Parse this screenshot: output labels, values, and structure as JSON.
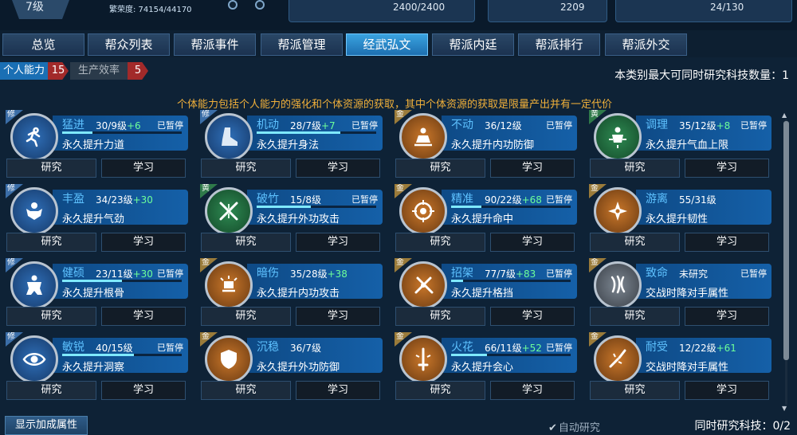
{
  "header": {
    "level": "7级",
    "prosperity": "繁荣度: 74154/44170",
    "stat1": "2400/2400",
    "stat2": "2209",
    "stat3": "24/130"
  },
  "tabs": [
    "总览",
    "帮众列表",
    "帮派事件",
    "帮派管理",
    "经武弘文",
    "帮派内廷",
    "帮派排行",
    "帮派外交"
  ],
  "active_tab": 4,
  "categories": [
    {
      "name": "个人能力",
      "count": "15"
    },
    {
      "name": "生产效率",
      "count": "5"
    }
  ],
  "max_research_label": "本类别最大可同时研究科技数量：1",
  "description": "个体能力包括个人能力的强化和个体资源的获取，其中个体资源的获取是限量产出并有一定代价",
  "labels": {
    "research": "研究",
    "learn": "学习",
    "paused": "已暂停"
  },
  "skills": [
    {
      "corner": "修",
      "name": "猛进",
      "level": "30/9级",
      "bonus": "+6",
      "effect": "永久提升力道",
      "paused": true,
      "progress": 0.25,
      "icon": "running-figure-icon",
      "color": "blue"
    },
    {
      "corner": "修",
      "name": "机动",
      "level": "28/7级",
      "bonus": "+7",
      "effect": "永久提升身法",
      "paused": true,
      "progress": 0.7,
      "icon": "boot-icon",
      "color": "blue"
    },
    {
      "corner": "金",
      "name": "不动",
      "level": "36/12级",
      "bonus": "",
      "effect": "永久提升内功防御",
      "paused": true,
      "progress": 0.0,
      "icon": "meditating-figure-icon",
      "color": "orange"
    },
    {
      "corner": "黄",
      "name": "调理",
      "level": "35/12级",
      "bonus": "+8",
      "effect": "永久提升气血上限",
      "paused": true,
      "progress": 0.0,
      "icon": "healing-figure-icon",
      "color": "green"
    },
    {
      "corner": "修",
      "name": "丰盈",
      "level": "34/23级",
      "bonus": "+30",
      "effect": "永久提升气劲",
      "paused": false,
      "progress": 0.0,
      "icon": "muscle-figure-icon",
      "color": "blue"
    },
    {
      "corner": "黄",
      "name": "破竹",
      "level": "15/8级",
      "bonus": "",
      "effect": "永久提升外功攻击",
      "paused": true,
      "progress": 0.45,
      "icon": "crossed-swords-icon",
      "color": "green"
    },
    {
      "corner": "金",
      "name": "精准",
      "level": "90/22级",
      "bonus": "+68",
      "effect": "永久提升命中",
      "paused": true,
      "progress": 0.25,
      "icon": "target-icon",
      "color": "orange"
    },
    {
      "corner": "金",
      "name": "游离",
      "level": "55/31级",
      "bonus": "",
      "effect": "永久提升韧性",
      "paused": false,
      "progress": 0.0,
      "icon": "shuriken-icon",
      "color": "orange"
    },
    {
      "corner": "修",
      "name": "健硕",
      "level": "23/11级",
      "bonus": "+30",
      "effect": "永久提升根骨",
      "paused": true,
      "progress": 0.5,
      "icon": "torso-icon",
      "color": "blue"
    },
    {
      "corner": "金",
      "name": "暗伤",
      "level": "35/28级",
      "bonus": "+38",
      "effect": "永久提升内功攻击",
      "paused": false,
      "progress": 0.0,
      "icon": "fist-aura-icon",
      "color": "orange"
    },
    {
      "corner": "金",
      "name": "招架",
      "level": "77/7级",
      "bonus": "+83",
      "effect": "永久提升格挡",
      "paused": true,
      "progress": 0.1,
      "icon": "parry-icon",
      "color": "orange"
    },
    {
      "corner": "金",
      "name": "致命",
      "level": "未研究",
      "bonus": "",
      "effect": "交战时降对手属性",
      "paused": true,
      "progress": 0.0,
      "icon": "claw-icon",
      "color": "silver"
    },
    {
      "corner": "修",
      "name": "敏锐",
      "level": "40/15级",
      "bonus": "",
      "effect": "永久提升洞察",
      "paused": true,
      "progress": 0.6,
      "icon": "eye-icon",
      "color": "blue"
    },
    {
      "corner": "金",
      "name": "沉稳",
      "level": "36/7级",
      "bonus": "",
      "effect": "永久提升外功防御",
      "paused": false,
      "progress": 0.0,
      "icon": "shield-icon",
      "color": "orange"
    },
    {
      "corner": "金",
      "name": "火花",
      "level": "66/11级",
      "bonus": "+52",
      "effect": "永久提升会心",
      "paused": true,
      "progress": 0.3,
      "icon": "sword-burst-icon",
      "color": "orange"
    },
    {
      "corner": "金",
      "name": "耐受",
      "level": "12/22级",
      "bonus": "+61",
      "effect": "交战时降对手属性",
      "paused": false,
      "progress": 0.0,
      "icon": "broken-blade-icon",
      "color": "orange"
    }
  ],
  "footer": {
    "show_attr": "显示加成属性",
    "auto_research": "自动研究",
    "simultaneous": "同时研究科技：0/2"
  }
}
